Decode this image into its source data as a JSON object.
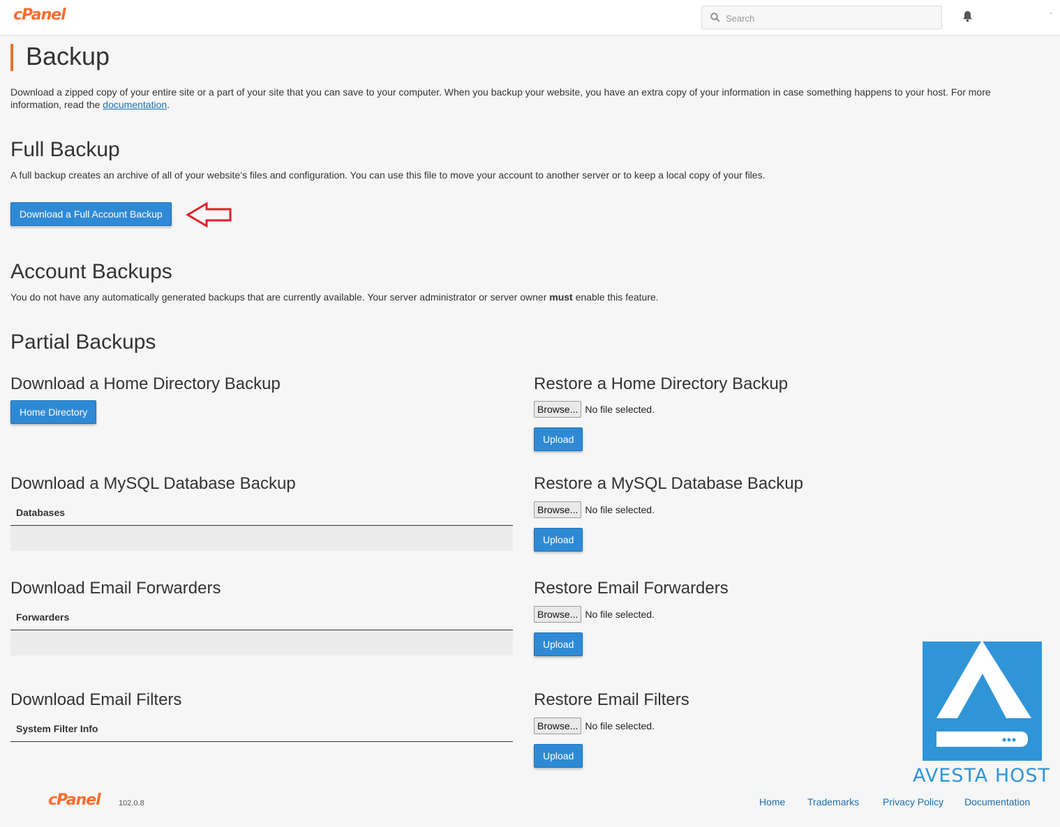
{
  "header": {
    "logo": "cPanel",
    "search_placeholder": "Search"
  },
  "page": {
    "title": "Backup",
    "intro_text": "Download a zipped copy of your entire site or a part of your site that you can save to your computer. When you backup your website, you have an extra copy of your information in case something happens to your host. For more information, read the ",
    "intro_link": "documentation",
    "intro_end": "."
  },
  "full_backup": {
    "heading": "Full Backup",
    "description": "A full backup creates an archive of all of your website’s files and configuration. You can use this file to move your account to another server or to keep a local copy of your files.",
    "button": "Download a Full Account Backup"
  },
  "account_backups": {
    "heading": "Account Backups",
    "desc_before": "You do not have any automatically generated backups that are currently available. Your server administrator or server owner ",
    "desc_bold": "must",
    "desc_after": " enable this feature."
  },
  "partial_backups": {
    "heading": "Partial Backups",
    "home_download_heading": "Download a Home Directory Backup",
    "home_button": "Home Directory",
    "home_restore_heading": "Restore a Home Directory Backup",
    "mysql_download_heading": "Download a MySQL Database Backup",
    "mysql_table_header": "Databases",
    "mysql_restore_heading": "Restore a MySQL Database Backup",
    "forwarders_download_heading": "Download Email Forwarders",
    "forwarders_table_header": "Forwarders",
    "forwarders_restore_heading": "Restore Email Forwarders",
    "filters_download_heading": "Download Email Filters",
    "filters_table_header": "System Filter Info",
    "filters_restore_heading": "Restore Email Filters",
    "browse_label": "Browse...",
    "no_file": "No file selected.",
    "upload_label": "Upload"
  },
  "watermark": {
    "brand": "AVESTA HOST"
  },
  "footer": {
    "logo": "cPanel",
    "version": "102.0.8",
    "links": [
      "Home",
      "Trademarks",
      "Privacy Policy",
      "Documentation"
    ]
  },
  "colors": {
    "primary_button": "#2f8ad5",
    "accent": "#e8712c",
    "link": "#1a6fb0",
    "arrow": "#e0202a",
    "brand_blue": "#2f95d7"
  }
}
